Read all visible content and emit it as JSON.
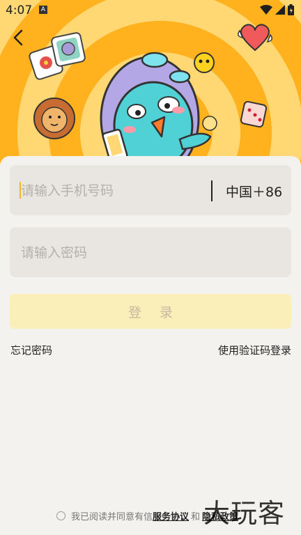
{
  "status_bar": {
    "time": "4:07",
    "app_icon_letter": "A"
  },
  "login_form": {
    "phone_placeholder": "请输入手机号码",
    "country_code": "中国＋86",
    "password_placeholder": "请输入密码",
    "login_button": "登 录",
    "forgot_password": "忘记密码",
    "sms_login": "使用验证码登录"
  },
  "agreement": {
    "prefix": "我已阅读并同意有信",
    "service_link": "服务协议",
    "connector": "和",
    "privacy_link": "隐私政策"
  },
  "watermark": "大玩客",
  "colors": {
    "accent": "#ffb21d",
    "button_bg": "#fbefb9",
    "field_bg": "#e9e6e1"
  }
}
